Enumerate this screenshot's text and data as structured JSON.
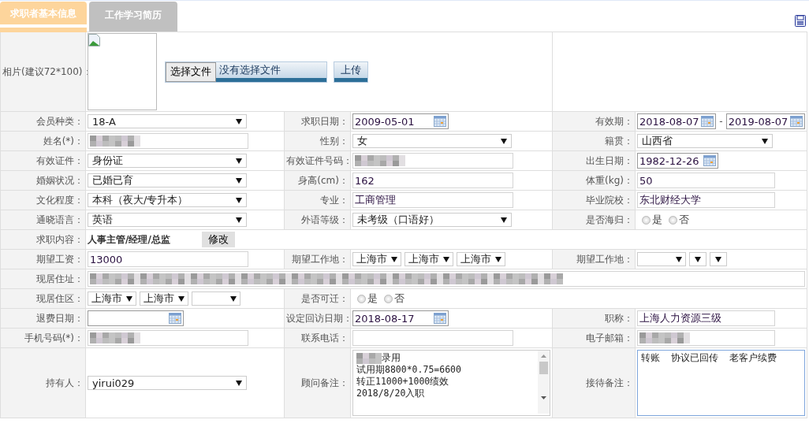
{
  "tabs": [
    {
      "label": "求职者基本信息",
      "selected": true
    },
    {
      "label": "工作学习简历",
      "selected": false
    }
  ],
  "photo": {
    "label": "相片(建议72*100)：",
    "choose_button": "选择文件",
    "file_status": "没有选择文件",
    "upload_button": "上传"
  },
  "rows": [
    [
      {
        "label": "会员种类：",
        "fields": [
          {
            "kind": "select",
            "value": "18-A"
          }
        ]
      },
      {
        "label": "求职日期：",
        "fields": [
          {
            "kind": "date",
            "value": "2009-05-01"
          }
        ]
      },
      {
        "label": "有效期：",
        "fields": [
          {
            "kind": "date",
            "value": "2018-08-07"
          },
          {
            "kind": "separator",
            "value": "-"
          },
          {
            "kind": "date",
            "value": "2019-08-07"
          }
        ]
      }
    ],
    [
      {
        "label": "姓名(*)：",
        "fields": [
          {
            "kind": "text",
            "redacted": true
          }
        ]
      },
      {
        "label": "性别：",
        "fields": [
          {
            "kind": "select",
            "value": "女"
          }
        ]
      },
      {
        "label": "籍贯：",
        "fields": [
          {
            "kind": "select",
            "value": "山西省"
          }
        ]
      }
    ],
    [
      {
        "label": "有效证件：",
        "fields": [
          {
            "kind": "select",
            "value": "身份证"
          }
        ]
      },
      {
        "label": "有效证件号码：",
        "fields": [
          {
            "kind": "text",
            "redacted": true
          }
        ]
      },
      {
        "label": "出生日期：",
        "fields": [
          {
            "kind": "date",
            "value": "1982-12-26"
          }
        ]
      }
    ],
    [
      {
        "label": "婚姻状况：",
        "fields": [
          {
            "kind": "select",
            "value": "已婚已育"
          }
        ]
      },
      {
        "label": "身高(cm)：",
        "fields": [
          {
            "kind": "text",
            "value": "162"
          }
        ]
      },
      {
        "label": "体重(kg)：",
        "fields": [
          {
            "kind": "text",
            "value": "50"
          }
        ]
      }
    ],
    [
      {
        "label": "文化程度：",
        "fields": [
          {
            "kind": "select",
            "value": "本科（夜大/专升本）"
          }
        ]
      },
      {
        "label": "专业：",
        "fields": [
          {
            "kind": "text",
            "value": "工商管理"
          }
        ]
      },
      {
        "label": "毕业院校：",
        "fields": [
          {
            "kind": "text",
            "value": "东北财经大学"
          }
        ]
      }
    ],
    [
      {
        "label": "通晓语言：",
        "fields": [
          {
            "kind": "select",
            "value": "英语"
          }
        ]
      },
      {
        "label": "外语等级：",
        "fields": [
          {
            "kind": "select",
            "value": "未考级（口语好）"
          }
        ]
      },
      {
        "label": "是否海归：",
        "fields": [
          {
            "kind": "radio",
            "options": [
              {
                "label": "是",
                "selected": false
              },
              {
                "label": "否",
                "selected": false
              }
            ]
          }
        ]
      }
    ],
    [
      {
        "label": "求职内容：",
        "fields": [
          {
            "kind": "strong-text",
            "value": "人事主管/经理/总监"
          },
          {
            "kind": "button",
            "value": "修改"
          }
        ]
      }
    ],
    [
      {
        "label": "期望工资：",
        "fields": [
          {
            "kind": "text",
            "value": "13000"
          }
        ]
      },
      {
        "label": "期望工作地：",
        "fields": [
          {
            "kind": "area-select",
            "value": "上海市"
          },
          {
            "kind": "area-select",
            "value": "上海市"
          },
          {
            "kind": "area-select",
            "value": "上海市"
          }
        ]
      },
      {
        "label": "期望工作地：",
        "fields": [
          {
            "kind": "area-select"
          },
          {
            "kind": "mini-select"
          },
          {
            "kind": "mini-select"
          }
        ]
      }
    ],
    [
      {
        "label": "现居住址：",
        "fields": [
          {
            "kind": "wide-text",
            "redacted": true
          }
        ]
      }
    ],
    [
      {
        "label": "现居住区：",
        "fields": [
          {
            "kind": "area-select",
            "value": "上海市"
          },
          {
            "kind": "area-select",
            "value": "上海市"
          },
          {
            "kind": "area-select"
          }
        ]
      },
      {
        "label": "是否可迁：",
        "fields": [
          {
            "kind": "radio",
            "options": [
              {
                "label": "是",
                "selected": false
              },
              {
                "label": "否",
                "selected": false
              }
            ]
          }
        ]
      }
    ],
    [
      {
        "label": "退费日期：",
        "fields": [
          {
            "kind": "date"
          }
        ]
      },
      {
        "label": "设定回访日期：",
        "fields": [
          {
            "kind": "date",
            "value": "2018-08-17"
          }
        ]
      },
      {
        "label": "职称：",
        "fields": [
          {
            "kind": "text",
            "value": "上海人力资源三级"
          }
        ]
      }
    ],
    [
      {
        "label": "手机号码(*)：",
        "fields": [
          {
            "kind": "text",
            "redacted": true
          }
        ]
      },
      {
        "label": "联系电话：",
        "fields": [
          {
            "kind": "text"
          }
        ]
      },
      {
        "label": "电子邮箱：",
        "fields": [
          {
            "kind": "text",
            "redacted": true
          }
        ]
      }
    ],
    [
      {
        "label": "持有人：",
        "fields": [
          {
            "kind": "select",
            "value": "yirui029"
          }
        ]
      },
      {
        "label": "顾问备注：",
        "fields": [
          {
            "kind": "textarea",
            "focused": false,
            "lines": [
              {
                "text": "录用",
                "redacted": true
              },
              {
                "text": "试用期8800*0.75=6600"
              },
              {
                "text": "转正11000+1000绩效"
              },
              {
                "text": "2018/8/20入职"
              }
            ]
          }
        ]
      },
      {
        "label": "接待备注：",
        "fields": [
          {
            "kind": "textarea",
            "focused": true,
            "lines": [
              {
                "text": "转账  协议已回传  老客户续费"
              }
            ]
          }
        ]
      }
    ]
  ]
}
